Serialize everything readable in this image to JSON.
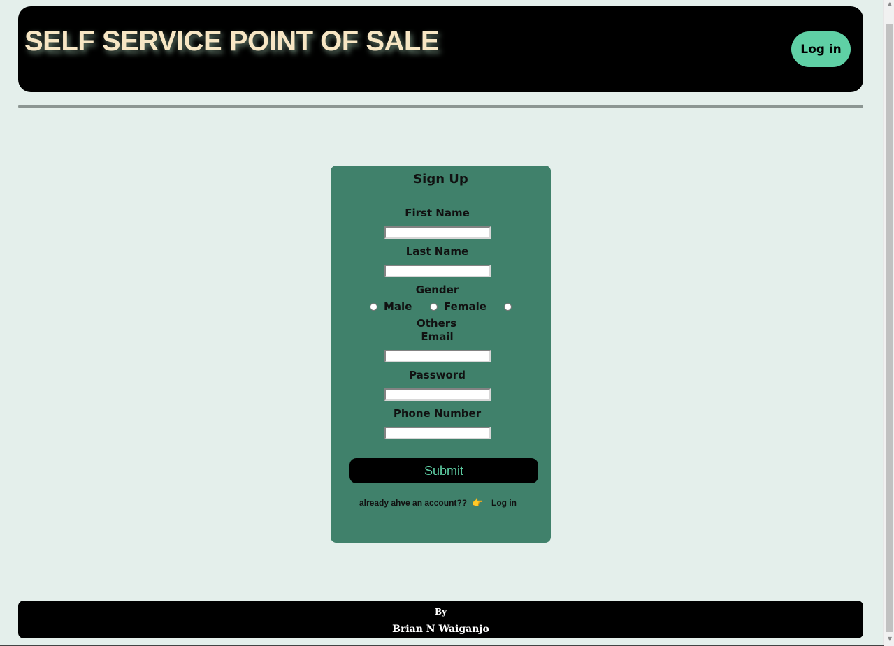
{
  "header": {
    "title": "SELF SERVICE POINT OF SALE",
    "login_label": "Log in"
  },
  "form": {
    "title": "Sign Up",
    "first_name_label": "First Name",
    "last_name_label": "Last Name",
    "gender_label": "Gender",
    "gender_options": [
      "Male",
      "Female",
      "Others"
    ],
    "email_label": "Email",
    "password_label": "Password",
    "phone_label": "Phone Number",
    "submit_label": "Submit",
    "already_text": "already ahve an account??",
    "hand_icon": "👉",
    "login_link": "Log in"
  },
  "footer": {
    "by": "By",
    "author": "Brian N Waiganjo"
  },
  "colors": {
    "accent": "#5fd0a5",
    "card": "#40816b",
    "background": "#e4efeb",
    "title": "#f7e6c4"
  }
}
